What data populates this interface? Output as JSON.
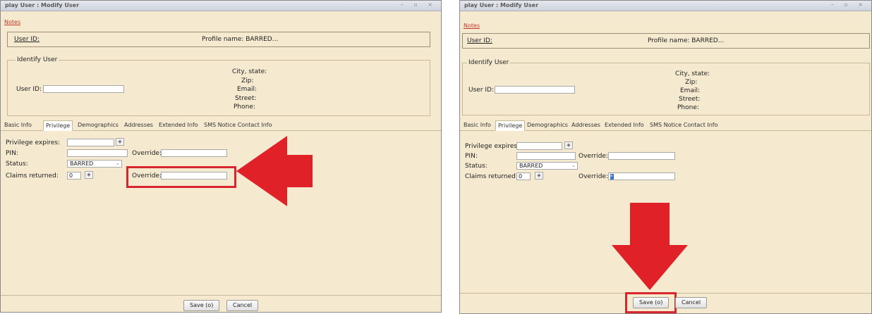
{
  "window": {
    "title": "play User : Modify User",
    "notes_link": "Notes",
    "user_id_label": "User ID:",
    "profile_name": "Profile name: BARRED...",
    "identify_user": {
      "legend": "Identify User",
      "user_id_label": "User ID:",
      "city_state_label": "City, state:",
      "zip_label": "Zip:",
      "email_label": "Email:",
      "street_label": "Street:",
      "phone_label": "Phone:"
    },
    "tabs": [
      "Basic Info",
      "Privilege",
      "Demographics",
      "Addresses",
      "Extended Info",
      "SMS Notice Contact Info"
    ],
    "active_tab": "Privilege",
    "privilege": {
      "privilege_expires_label": "Privilege expires:",
      "pin_label": "PIN:",
      "override_label": "Override:",
      "status_label": "Status:",
      "status_value": "BARRED",
      "claims_returned_label": "Claims returned:",
      "claims_returned_value": "0",
      "claims_override_label": "Override:",
      "claims_override_value_right": "*"
    },
    "buttons": {
      "save": "Save (o)",
      "cancel": "Cancel"
    }
  },
  "colors": {
    "annotation_red": "#d9262e",
    "panel_bg": "#f5e9d0"
  }
}
